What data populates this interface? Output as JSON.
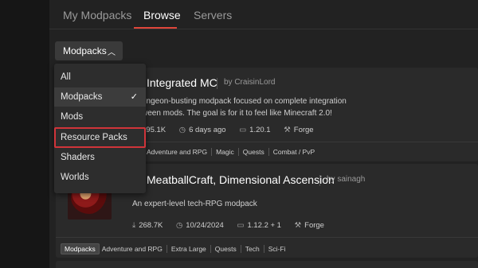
{
  "tabs": [
    {
      "label": "My Modpacks"
    },
    {
      "label": "Browse"
    },
    {
      "label": "Servers"
    }
  ],
  "active_tab": "Browse",
  "type_select": {
    "label": "Modpacks",
    "icon": "chevron-up-icon"
  },
  "dropdown": {
    "items": [
      {
        "label": "All"
      },
      {
        "label": "Modpacks",
        "selected": true
      },
      {
        "label": "Mods"
      },
      {
        "label": "Resource Packs",
        "highlighted": true
      },
      {
        "label": "Shaders"
      },
      {
        "label": "Worlds"
      }
    ],
    "check": "✓"
  },
  "cards": [
    {
      "title": "Integrated MC",
      "by": "by CraisinLord",
      "desc_line1": "ungeon-busting modpack focused on complete integration",
      "desc_line2": "ween mods. The goal is for it to feel like Minecraft 2.0!",
      "downloads": "395.1K",
      "updated": "6 days ago",
      "version": "1.20.1",
      "loader": "Forge",
      "tags": [
        "Adventure and RPG",
        "Magic",
        "Quests",
        "Combat / PvP"
      ]
    },
    {
      "title": "MeatballCraft, Dimensional Ascension",
      "by": "by sainagh",
      "desc": "An expert-level tech-RPG modpack",
      "downloads": "268.7K",
      "updated": "10/24/2024",
      "version": "1.12.2 + 1",
      "loader": "Forge",
      "primary_tag": "Modpacks",
      "tags": [
        "Adventure and RPG",
        "Extra Large",
        "Quests",
        "Tech",
        "Sci-Fi"
      ]
    }
  ],
  "colors": {
    "accent": "#e0463a",
    "highlight_border": "#d0343a"
  }
}
